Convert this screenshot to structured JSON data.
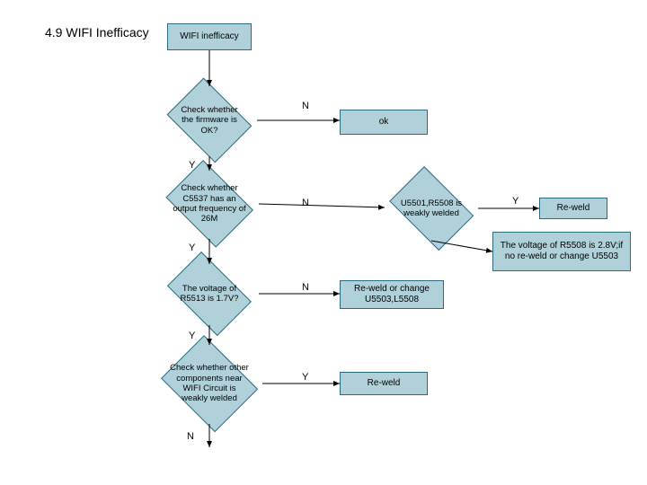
{
  "title": "4.9 WIFI Inefficacy",
  "nodes": {
    "start": "WIFI inefficacy",
    "d1": "Check whether the firmware is OK?",
    "r1": "ok",
    "d2": "Check whether C5537 has an output frequency of 26M",
    "d3": "U5501,R5508 is weakly welded",
    "r3a": "Re-weld",
    "r3b": "The voltage of R5508 is 2.8V;if no re-weld or change U5503",
    "d4": "The voltage of R5513 is 1.7V?",
    "r4": "Re-weld or change U5503,L5508",
    "d5": "Check whether other components near WIFI Circuit is weakly welded",
    "r5": "Re-weld"
  },
  "labels": {
    "Y": "Y",
    "N": "N"
  }
}
